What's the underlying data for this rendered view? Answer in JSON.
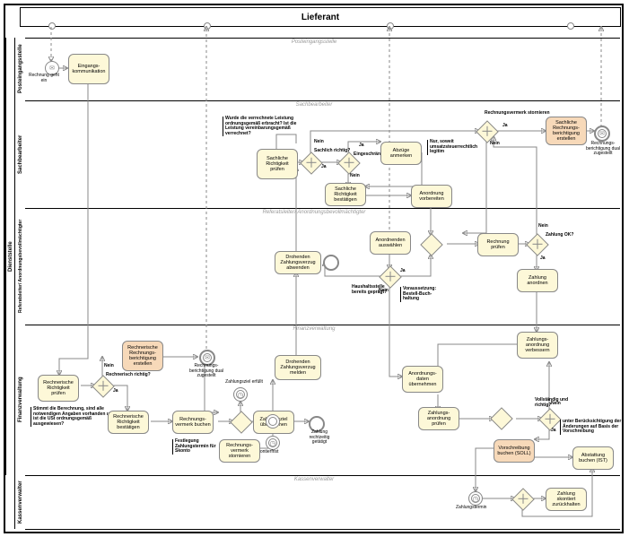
{
  "pool": {
    "name": "Lieferant"
  },
  "lanes": {
    "l1": {
      "label": "Posteingangsstelle",
      "group": "Posteingangsstelle"
    },
    "l2": {
      "label": "Sachbearbeiter",
      "group": "Sachbearbeiter"
    },
    "l3": {
      "label": "Referatsleiter/\nAnordnungsbevollmächtigter",
      "group": "Referatsleiter/ Anordnungsbevollmächtigter"
    },
    "l4": {
      "label": "Finanzverwaltung",
      "group": "Finanzverwaltung"
    },
    "l5": {
      "label": "Kassenverwalter",
      "group": "Kassenverwalter"
    },
    "lgroup": {
      "label": "Dienststelle"
    }
  },
  "events": {
    "start": {
      "label": "Rechnung\ngeht ein"
    },
    "endDual1": {
      "label": "Rechnungs-\nberichtigung\ndual zugestellt"
    },
    "endDual2": {
      "label": "Rechnungs-\nberichtigung\ndual zugestellt"
    },
    "timer1": {
      "label": "Zahlungsziel\nerfüllt"
    },
    "timer2": {
      "label": "Skontierfrist"
    },
    "endRecht": {
      "label": "Zahlung\nrechtzeitig\ngetätigt"
    },
    "endVerzug": {
      "label": ""
    },
    "timerZT": {
      "label": "Zahlungstermin"
    }
  },
  "tasks": {
    "t1": {
      "label": "Eingangs-\nkommunikation"
    },
    "t2": {
      "label": "Sachliche\nRichtigkeit\nprüfen"
    },
    "t3": {
      "label": "Abzüge\nanmerken"
    },
    "t4": {
      "label": "Sachliche\nRichtigkeit\nbestätigen"
    },
    "t5": {
      "label": "Anordnung\nvorbereiten"
    },
    "t6": {
      "label": "Sachliche\nRechnungs-\nberichtigung\nerstellen"
    },
    "t7": {
      "label": "Anordnenden\nauswählen"
    },
    "t8": {
      "label": "Drohenden\nZahlungsverzug\nabwenden"
    },
    "t9": {
      "label": "Rechnung\nprüfen"
    },
    "t10": {
      "label": "Zahlung\nanordnen"
    },
    "t11": {
      "label": "Zahlungs-\nanordnung\nverbessern"
    },
    "t12": {
      "label": "Anordnungs-\ndaten\nübernehmen"
    },
    "t13": {
      "label": "Rechnerische\nRichtigkeit\nprüfen"
    },
    "t14": {
      "label": "Rechnerische\nRechnungs-\nberichtigung\nerstellen"
    },
    "t15": {
      "label": "Rechnerische\nRichtigkeit\nbestätigen"
    },
    "t16": {
      "label": "Rechnungs-\nvermerk buchen"
    },
    "t17": {
      "label": "Zahlungsziel\nüberwachen"
    },
    "t18": {
      "label": "Rechnungs-\nvermerk\nstornieren"
    },
    "t19": {
      "label": "Drohenden\nZahlungsverzug\nmelden"
    },
    "t20": {
      "label": "Zahlungs-\nanordnung\nprüfen"
    },
    "t21": {
      "label": "Vorschreibung\nbuchen (SOLL)"
    },
    "t22": {
      "label": "Abstattung\nbuchen (IST)"
    },
    "t23": {
      "label": "Zahlung\nskontiert\nzurückhalten"
    }
  },
  "gateways": {
    "gSach": {
      "label": "Sachlich\nrichtig?"
    },
    "gEinge": {
      "label": "Eingeschränkt"
    },
    "gPlus": {
      "label": ""
    },
    "gRech": {
      "label": "Rechnerisch\nrichtig?"
    },
    "gEvent": {
      "label": ""
    },
    "gHaus": {
      "label": "Haushaltsstelle\nbereits geprägt?"
    },
    "gStorno": {
      "label": "Rechnungsvermerk\nstornieren"
    },
    "gZahl": {
      "label": "Zahlung\nOK?"
    },
    "gVoll": {
      "label": "Vollständig\nund richtig?"
    },
    "gSkonto": {
      "label": ""
    }
  },
  "annotations": {
    "sachQ": {
      "text": "Wurde die verrechnete\nLeistung ordnungsgemäß\nerbracht? Ist die Leistung\nvereinbarungsgemäß\nverrechnet?"
    },
    "umsatz": {
      "text": "Nur, soweit\numsatzsteuerrechtlich\nlegitim"
    },
    "bestell": {
      "text": "Voraussetzung:\nBestell-Buch-\nhaltung"
    },
    "rechQ": {
      "text": "Stimmt die Berechnung, sind\nalle notwendigen Angaben\nvorhanden und ist die USt\nordnungsgemäß ausgewiesen?"
    },
    "fest": {
      "text": "Festlegung\nZahlungstermin\nfür Skonto"
    },
    "beruck": {
      "text": "unter Berücksichtigung\nder Änderungen auf\nBasis der Vorschreibung"
    }
  },
  "edgeLabels": {
    "nein": "Nein",
    "ja": "Ja"
  }
}
